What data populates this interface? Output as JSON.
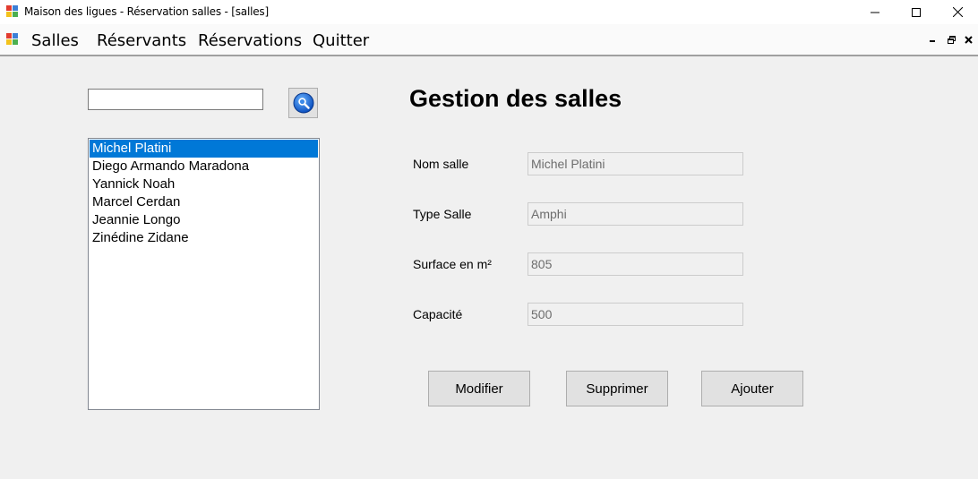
{
  "window": {
    "title": "Maison des ligues - Réservation salles - [salles]"
  },
  "menu": {
    "items": [
      "Salles",
      "Réservants",
      "Réservations",
      "Quitter"
    ]
  },
  "search": {
    "value": ""
  },
  "list": {
    "items": [
      "Michel Platini",
      "Diego Armando Maradona",
      "Yannick Noah",
      "Marcel Cerdan",
      "Jeannie Longo",
      "Zinédine Zidane"
    ],
    "selected_index": 0
  },
  "form": {
    "heading": "Gestion des salles",
    "fields": [
      {
        "label": "Nom salle",
        "value": "Michel Platini"
      },
      {
        "label": "Type Salle",
        "value": "Amphi"
      },
      {
        "label": "Surface en m²",
        "value": "805"
      },
      {
        "label": "Capacité",
        "value": "500"
      }
    ]
  },
  "buttons": {
    "modify": "Modifier",
    "delete": "Supprimer",
    "add": "Ajouter"
  },
  "colors": {
    "selection": "#0078d7",
    "background": "#f0f0f0",
    "button_face": "#e1e1e1"
  },
  "icons": [
    "app-icon",
    "minimize-icon",
    "maximize-icon",
    "close-icon",
    "search-icon",
    "mdi-minimize-icon",
    "mdi-restore-icon",
    "mdi-close-icon"
  ]
}
